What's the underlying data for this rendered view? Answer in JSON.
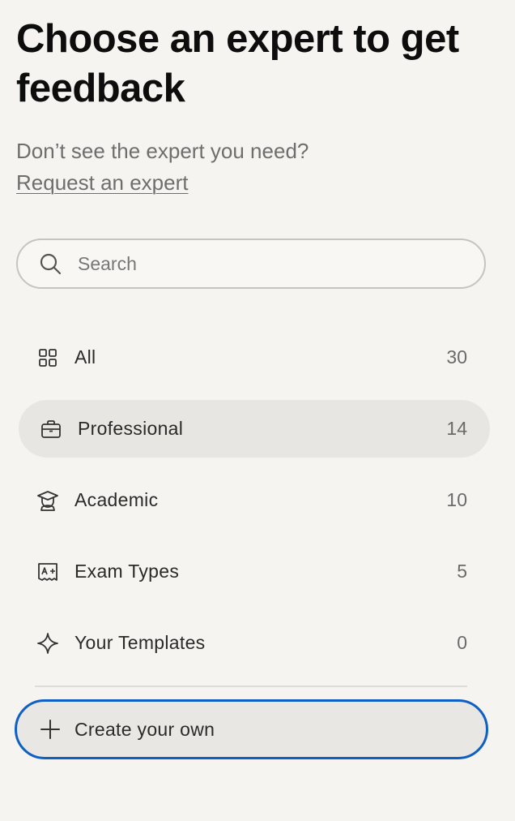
{
  "header": {
    "title": "Choose an expert to get feedback",
    "subtitle": "Don’t see the expert you need?",
    "request_link": "Request an expert"
  },
  "search": {
    "placeholder": "Search",
    "value": ""
  },
  "categories": [
    {
      "label": "All",
      "count": "30",
      "icon": "grid-icon",
      "active": false
    },
    {
      "label": "Professional",
      "count": "14",
      "icon": "briefcase-icon",
      "active": true
    },
    {
      "label": "Academic",
      "count": "10",
      "icon": "graduate-icon",
      "active": false
    },
    {
      "label": "Exam Types",
      "count": "5",
      "icon": "exam-grade-icon",
      "active": false
    },
    {
      "label": "Your Templates",
      "count": "0",
      "icon": "sparkle-icon",
      "active": false
    }
  ],
  "create": {
    "label": "Create your own",
    "icon": "plus-icon"
  },
  "colors": {
    "background": "#f5f4f0",
    "active_item": "#e7e6e3",
    "focus_ring": "#1060c4"
  }
}
